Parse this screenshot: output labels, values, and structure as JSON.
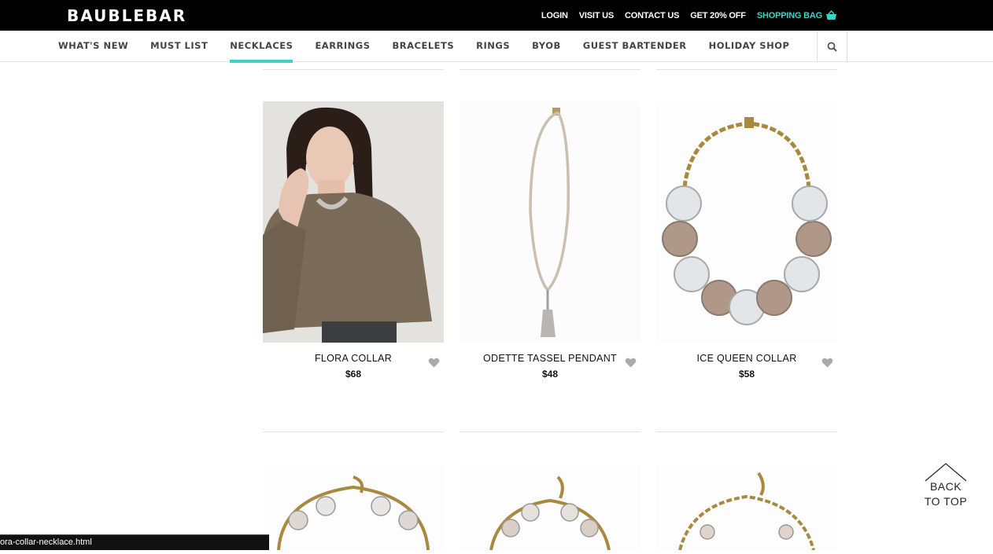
{
  "header": {
    "logo": "BAUBLEBAR",
    "links": [
      "LOGIN",
      "VISIT US",
      "CONTACT US",
      "GET 20% OFF"
    ],
    "bag_label": "SHOPPING BAG",
    "accent_color": "#3fd1c6"
  },
  "nav": {
    "items": [
      "WHAT'S NEW",
      "MUST LIST",
      "NECKLACES",
      "EARRINGS",
      "BRACELETS",
      "RINGS",
      "BYOB",
      "GUEST BARTENDER",
      "HOLIDAY SHOP"
    ],
    "active": "NECKLACES",
    "search_icon": "search-icon"
  },
  "products": [
    {
      "name": "FLORA COLLAR",
      "price": "$68"
    },
    {
      "name": "ODETTE TASSEL PENDANT",
      "price": "$48"
    },
    {
      "name": "ICE QUEEN COLLAR",
      "price": "$58"
    }
  ],
  "back_to_top": {
    "line1": "BACK",
    "line2": "TO TOP"
  },
  "status_url": "ora-collar-necklace.html"
}
